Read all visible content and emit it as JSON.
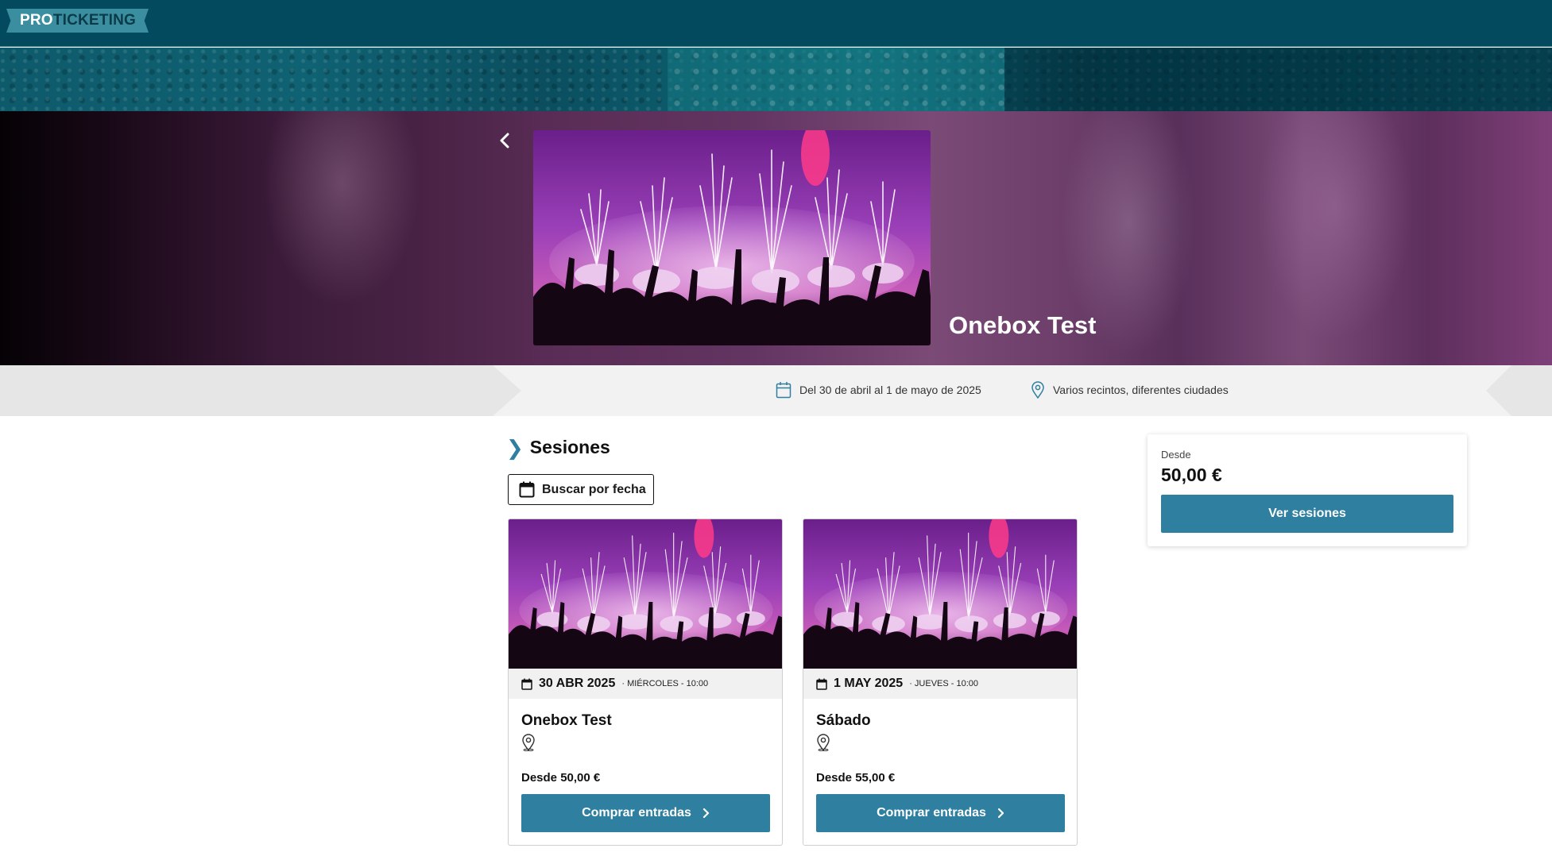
{
  "brand": {
    "pro": "PRO",
    "ticketing": "TICKETING"
  },
  "colors": {
    "topbar": "#034a5e",
    "accent": "#2f7fa0",
    "logo_bg": "#3a8ea0"
  },
  "event": {
    "title": "Onebox Test",
    "dates": "Del 30 de abril al 1 de mayo de 2025",
    "venue": "Varios recintos, diferentes ciudades"
  },
  "sessions": {
    "heading": "Sesiones",
    "search_label": "Buscar por fecha",
    "items": [
      {
        "date": "30 ABR 2025",
        "weekday_time": "· MIÉRCOLES - 10:00",
        "name": "Onebox Test",
        "price": "Desde 50,00 €",
        "button": "Comprar entradas"
      },
      {
        "date": "1 MAY 2025",
        "weekday_time": "· JUEVES - 10:00",
        "name": "Sábado",
        "price": "Desde 55,00 €",
        "button": "Comprar entradas"
      }
    ]
  },
  "price_box": {
    "from_label": "Desde",
    "amount": "50,00 €",
    "button": "Ver sesiones"
  },
  "icons": {
    "back": "chevron-left-icon",
    "calendar": "calendar-icon",
    "location": "location-pin-icon",
    "section": "chevron-right-icon"
  }
}
